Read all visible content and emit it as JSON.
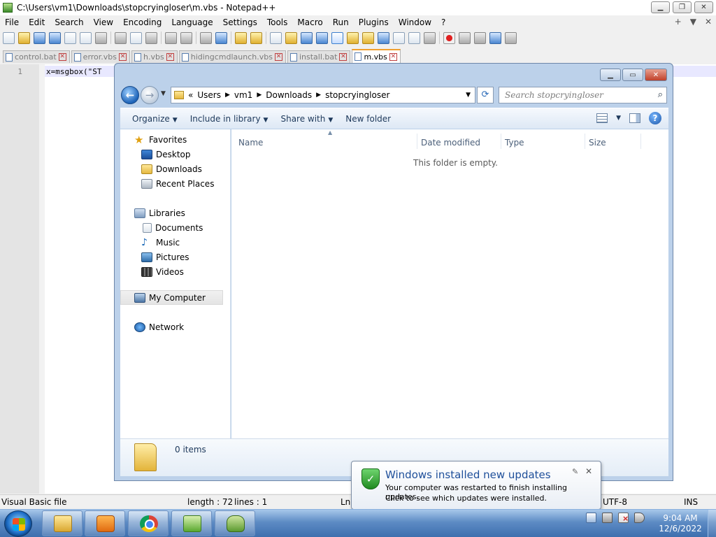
{
  "notepad": {
    "title": "C:\\Users\\vm1\\Downloads\\stopcryingloser\\m.vbs - Notepad++",
    "menu": [
      "File",
      "Edit",
      "Search",
      "View",
      "Encoding",
      "Language",
      "Settings",
      "Tools",
      "Macro",
      "Run",
      "Plugins",
      "Window",
      "?"
    ],
    "menu_right": [
      "+",
      "▼",
      "✕"
    ],
    "tabs": [
      {
        "label": "control.bat",
        "active": false
      },
      {
        "label": "error.vbs",
        "active": false
      },
      {
        "label": "h.vbs",
        "active": false
      },
      {
        "label": "hidingcmdlaunch.vbs",
        "active": false
      },
      {
        "label": "install.bat",
        "active": false
      },
      {
        "label": "m.vbs",
        "active": true
      }
    ],
    "line_number": "1",
    "code": "x=msgbox(\"ST",
    "status": {
      "filetype": "Visual Basic file",
      "length": "length : 72",
      "lines": "lines : 1",
      "position": "Ln",
      "encoding": "UTF-8",
      "mode": "INS"
    }
  },
  "explorer": {
    "breadcrumb": [
      "«",
      "Users",
      "vm1",
      "Downloads",
      "stopcryingloser"
    ],
    "search_placeholder": "Search stopcryingloser",
    "commands": [
      "Organize",
      "Include in library",
      "Share with",
      "New folder"
    ],
    "nav": {
      "favorites": "Favorites",
      "desktop": "Desktop",
      "downloads": "Downloads",
      "recent": "Recent Places",
      "libraries": "Libraries",
      "documents": "Documents",
      "music": "Music",
      "pictures": "Pictures",
      "videos": "Videos",
      "computer": "My Computer",
      "network": "Network"
    },
    "columns": [
      "Name",
      "Date modified",
      "Type",
      "Size"
    ],
    "empty_message": "This folder is empty.",
    "item_count": "0 items"
  },
  "notification": {
    "title": "Windows installed new updates",
    "line1": "Your computer was restarted to finish installing updates.",
    "line2": "Click to see which updates were installed."
  },
  "taskbar": {
    "time": "9:04 AM",
    "date": "12/6/2022"
  }
}
